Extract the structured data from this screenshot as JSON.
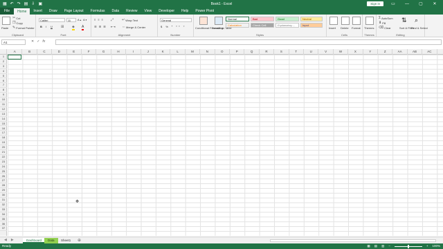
{
  "titlebar": {
    "title": "Book1 - Excel",
    "signin": "Sign in",
    "qat": [
      "↶",
      "↷",
      "▤",
      "⇩",
      "▣",
      "▦"
    ],
    "win": [
      "▭",
      "—",
      "▢",
      "✕"
    ]
  },
  "tabs": [
    "File",
    "Home",
    "Insert",
    "Draw",
    "Page Layout",
    "Formulas",
    "Data",
    "Review",
    "View",
    "Developer",
    "Help",
    "Power Pivot"
  ],
  "ribbon": {
    "clipboard": {
      "paste": "Paste",
      "cut": "Cut",
      "copy": "Copy",
      "format_painter": "Format Painter",
      "label": "Clipboard"
    },
    "font": {
      "name": "Calibri",
      "size": "11",
      "label": "Font"
    },
    "alignment": {
      "wrap": "Wrap Text",
      "merge": "Merge & Center",
      "label": "Alignment"
    },
    "number": {
      "format": "General",
      "label": "Number"
    },
    "styles": {
      "cond": "Conditional Formatting",
      "table": "Format as Table",
      "normal": "Normal",
      "bad": "Bad",
      "good": "Good",
      "neutral": "Neutral",
      "calculation": "Calculation",
      "check": "Check Cell",
      "explanatory": "Explanatory ...",
      "input": "Input",
      "label": "Styles"
    },
    "cells": {
      "insert": "Insert",
      "delete": "Delete",
      "format": "Format",
      "label": "Cells"
    },
    "themes": {
      "themes": "Themes",
      "label": "Themes"
    },
    "editing": {
      "autosum": "AutoSum",
      "fill": "Fill",
      "clear": "Clear",
      "sort": "Sort & Filter",
      "find": "Find & Select",
      "label": "Editing"
    }
  },
  "formula": {
    "namebox": "A1",
    "fx": "fx",
    "value": ""
  },
  "columns": [
    "A",
    "B",
    "C",
    "D",
    "E",
    "F",
    "G",
    "H",
    "I",
    "J",
    "K",
    "L",
    "M",
    "N",
    "O",
    "P",
    "Q",
    "R",
    "S",
    "T",
    "U",
    "V",
    "W",
    "X",
    "Y",
    "Z",
    "AA",
    "AB",
    "AC"
  ],
  "rows": [
    "1",
    "2",
    "3",
    "4",
    "5",
    "6",
    "7",
    "8",
    "9",
    "10",
    "11",
    "12",
    "13",
    "14",
    "15",
    "16",
    "17",
    "18",
    "19",
    "20",
    "21",
    "22",
    "23",
    "24",
    "25",
    "26",
    "27",
    "28",
    "29",
    "30",
    "31",
    "32",
    "33",
    "34",
    "35",
    "36",
    "37"
  ],
  "sheets": [
    "Dashboard",
    "Data",
    "Sheet1"
  ],
  "status": {
    "ready": "Ready",
    "zoom": "100%"
  },
  "colors": {
    "accent": "#217346",
    "data_tab": "#92d050"
  }
}
